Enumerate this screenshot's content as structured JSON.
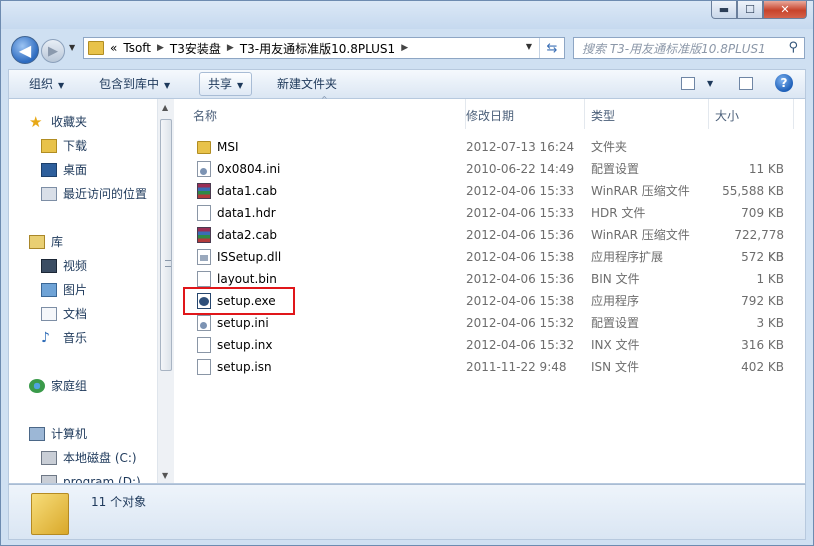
{
  "window": {
    "controls": {
      "minimize": "▬",
      "maximize": "☐",
      "close": "✕"
    }
  },
  "navigation": {
    "back_icon": "back-arrow-icon",
    "forward_icon": "forward-arrow-icon",
    "address_prefix": "«",
    "breadcrumbs": [
      "Tsoft",
      "T3安装盘",
      "T3-用友通标准版10.8PLUS1"
    ],
    "search_placeholder": "搜索 T3-用友通标准版10.8PLUS1"
  },
  "toolbar": {
    "organize": "组织",
    "include_in_library": "包含到库中",
    "share": "共享",
    "new_folder": "新建文件夹"
  },
  "sidebar": {
    "favorites": {
      "label": "收藏夹",
      "items": [
        "下载",
        "桌面",
        "最近访问的位置"
      ]
    },
    "libraries": {
      "label": "库",
      "items": [
        "视频",
        "图片",
        "文档",
        "音乐"
      ]
    },
    "homegroup": {
      "label": "家庭组"
    },
    "computer": {
      "label": "计算机",
      "items": [
        "本地磁盘 (C:)",
        "program (D:)"
      ]
    }
  },
  "columns": {
    "name": "名称",
    "date": "修改日期",
    "type": "类型",
    "size": "大小"
  },
  "files": [
    {
      "name": "MSI",
      "date": "2012-07-13 16:24",
      "type": "文件夹",
      "size": "",
      "icon": "folder"
    },
    {
      "name": "0x0804.ini",
      "date": "2010-06-22 14:49",
      "type": "配置设置",
      "size": "11 KB",
      "icon": "ini"
    },
    {
      "name": "data1.cab",
      "date": "2012-04-06 15:33",
      "type": "WinRAR 压缩文件",
      "size": "55,588 KB",
      "icon": "rar"
    },
    {
      "name": "data1.hdr",
      "date": "2012-04-06 15:33",
      "type": "HDR 文件",
      "size": "709 KB",
      "icon": "doc"
    },
    {
      "name": "data2.cab",
      "date": "2012-04-06 15:36",
      "type": "WinRAR 压缩文件",
      "size": "722,778 KB",
      "icon": "rar"
    },
    {
      "name": "ISSetup.dll",
      "date": "2012-04-06 15:38",
      "type": "应用程序扩展",
      "size": "572 KB",
      "icon": "dll"
    },
    {
      "name": "layout.bin",
      "date": "2012-04-06 15:36",
      "type": "BIN 文件",
      "size": "1 KB",
      "icon": "doc"
    },
    {
      "name": "setup.exe",
      "date": "2012-04-06 15:38",
      "type": "应用程序",
      "size": "792 KB",
      "icon": "exe"
    },
    {
      "name": "setup.ini",
      "date": "2012-04-06 15:32",
      "type": "配置设置",
      "size": "3 KB",
      "icon": "ini"
    },
    {
      "name": "setup.inx",
      "date": "2012-04-06 15:32",
      "type": "INX 文件",
      "size": "316 KB",
      "icon": "doc"
    },
    {
      "name": "setup.isn",
      "date": "2011-11-22 9:48",
      "type": "ISN 文件",
      "size": "402 KB",
      "icon": "doc"
    }
  ],
  "status": {
    "item_count": "11 个对象"
  },
  "colors": {
    "highlight": "#e0161a",
    "accent": "#1e395b"
  }
}
